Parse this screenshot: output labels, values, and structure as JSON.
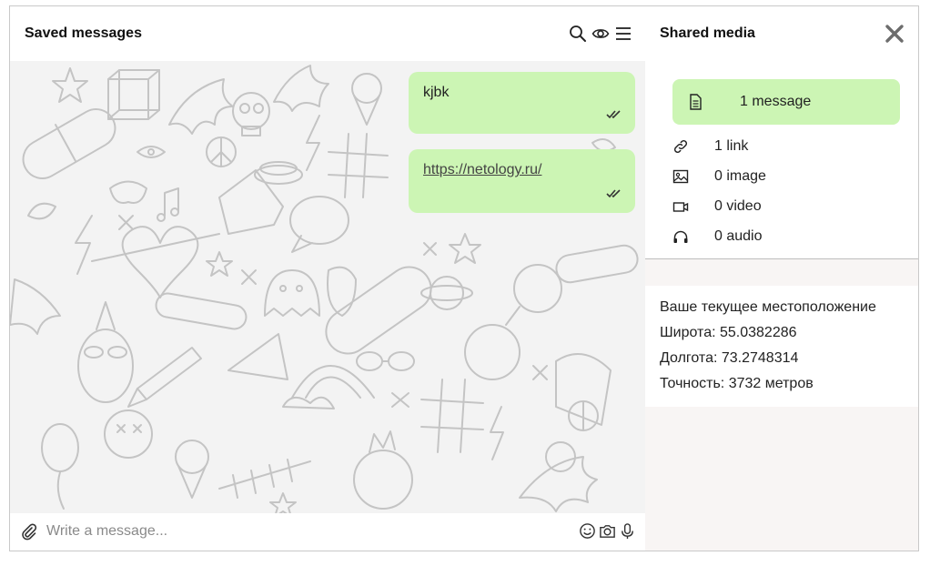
{
  "chat": {
    "title": "Saved messages",
    "icons": [
      "search-icon",
      "eye-icon",
      "menu-icon"
    ],
    "messages": [
      {
        "text": "kjbk",
        "status": "read"
      },
      {
        "link": "https://netology.ru/",
        "status": "read"
      }
    ],
    "composer": {
      "placeholder": "Write a message...",
      "icons": [
        "paperclip-icon",
        "smiley-icon",
        "camera-icon",
        "microphone-icon"
      ]
    }
  },
  "side": {
    "title": "Shared media",
    "items": [
      {
        "label": "1 message",
        "icon": "document-icon",
        "active": true
      },
      {
        "label": "1 link",
        "icon": "link-icon"
      },
      {
        "label": "0 image",
        "icon": "image-icon"
      },
      {
        "label": "0 video",
        "icon": "video-icon"
      },
      {
        "label": "0 audio",
        "icon": "headphones-icon"
      }
    ],
    "location": {
      "heading": "Ваше текущее местоположение",
      "latitude": "Широта: 55.0382286",
      "longitude": "Долгота: 73.2748314",
      "accuracy": "Точность: 3732 метров"
    }
  },
  "colors": {
    "bubble": "#ccf5b4",
    "chat_background": "#f3f3f3",
    "side_background": "#f8f5f4",
    "border": "#c9c9c9"
  }
}
